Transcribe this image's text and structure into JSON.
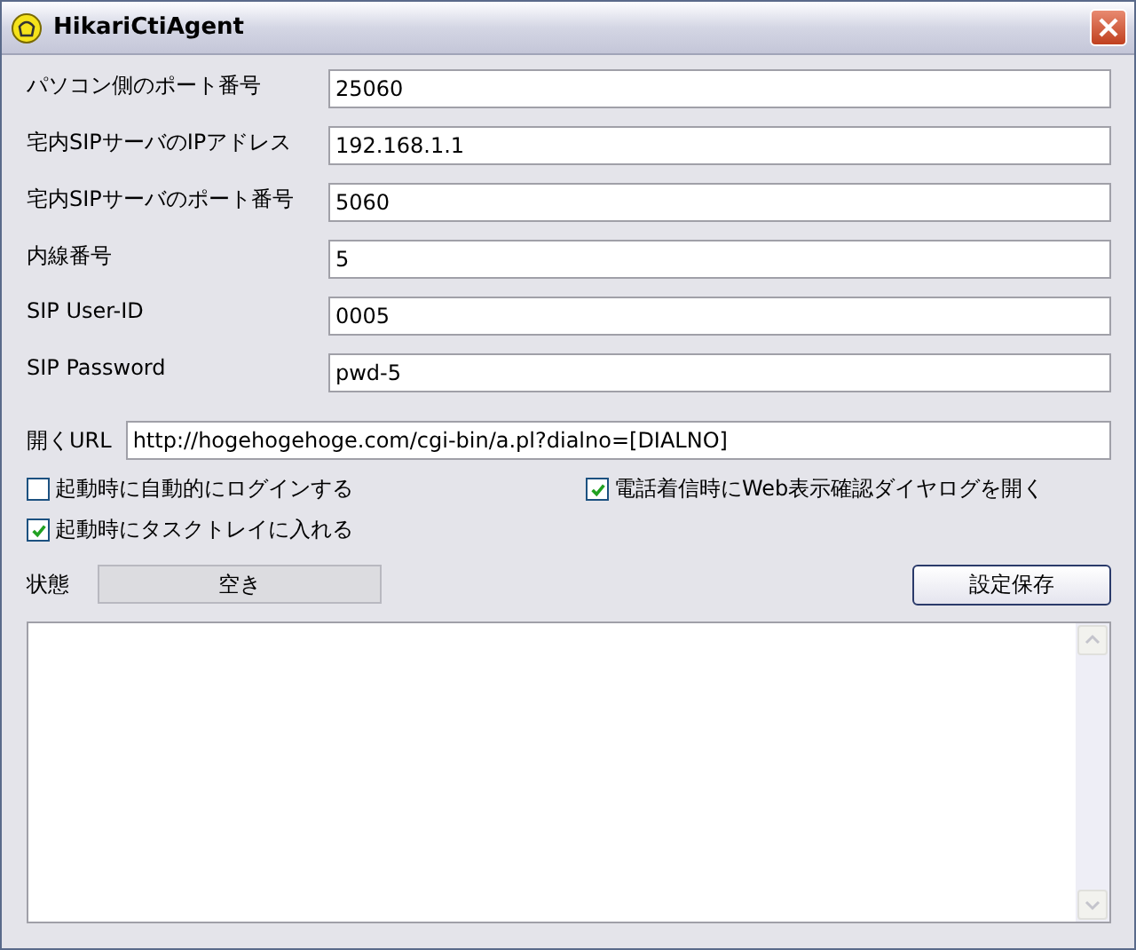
{
  "window": {
    "title": "HikariCtiAgent"
  },
  "fields": [
    {
      "label": "パソコン側のポート番号",
      "value": "25060"
    },
    {
      "label": "宅内SIPサーバのIPアドレス",
      "value": "192.168.1.1"
    },
    {
      "label": "宅内SIPサーバのポート番号",
      "value": "5060"
    },
    {
      "label": "内線番号",
      "value": "5"
    },
    {
      "label": "SIP User-ID",
      "value": "0005"
    },
    {
      "label": "SIP Password",
      "value": "pwd-5"
    }
  ],
  "url": {
    "label": "開くURL",
    "value": "http://hogehogehoge.com/cgi-bin/a.pl?dialno=[DIALNO]"
  },
  "checkboxes": [
    {
      "label": "起動時に自動的にログインする",
      "checked": false
    },
    {
      "label": "電話着信時にWeb表示確認ダイヤログを開く",
      "checked": true
    },
    {
      "label": "起動時にタスクトレイに入れる",
      "checked": true
    }
  ],
  "status": {
    "label": "状態",
    "value": "空き"
  },
  "save_button": "設定保存"
}
